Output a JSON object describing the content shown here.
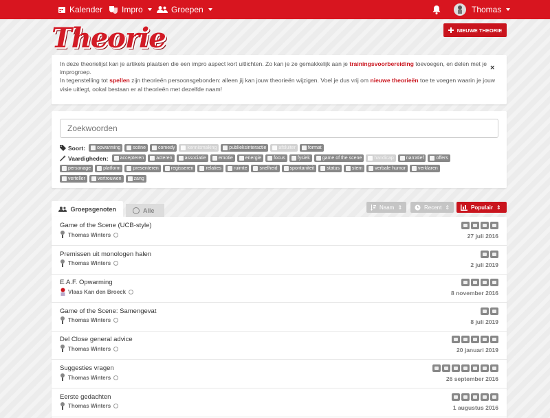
{
  "nav": {
    "calendar_label": "Kalender",
    "impro_label": "Impro",
    "groups_label": "Groepen",
    "user_name": "Thomas"
  },
  "page": {
    "logo_text": "Theorie",
    "new_button_label": "NIEUWE THEORIE"
  },
  "info": {
    "line1_a": "In deze theorielijst kan je artikels plaatsen die een impro aspect kort uitlichten. Zo kan je ze gemakkelijk aan je ",
    "line1_link": "trainingsvoorbereiding",
    "line1_b": " toevoegen, en delen met je improgroep.",
    "line2_a": "In tegenstelling tot ",
    "line2_link1": "spellen",
    "line2_b": " zijn theorieën persoonsgebonden: alleen jij kan jouw theorieën wijzigen. Voel je dus vrij om ",
    "line2_link2": "nieuwe theorieën",
    "line2_c": " toe te voegen waarin je jouw visie uitlegt, ookal bestaan er al theorieën met dezelfde naam!",
    "close": "×"
  },
  "search": {
    "placeholder": "Zoekwoorden",
    "sort_label": "Soort:",
    "sort_tags": [
      {
        "label": "opwarming",
        "light": false
      },
      {
        "label": "scène",
        "light": false
      },
      {
        "label": "comedy",
        "light": false
      },
      {
        "label": "kennismaking",
        "light": true
      },
      {
        "label": "publieksinteractie",
        "light": false
      },
      {
        "label": "afsluiter",
        "light": true
      },
      {
        "label": "format",
        "light": false
      }
    ],
    "skills_label": "Vaardigheden:",
    "skill_tags_row1": [
      {
        "label": "accepteren",
        "light": false
      },
      {
        "label": "acteren",
        "light": false
      },
      {
        "label": "associatie",
        "light": false
      },
      {
        "label": "emotie",
        "light": false
      },
      {
        "label": "energie",
        "light": false
      },
      {
        "label": "focus",
        "light": false
      },
      {
        "label": "fysiek",
        "light": false
      },
      {
        "label": "game of the scene",
        "light": false
      },
      {
        "label": "handicap",
        "light": true
      },
      {
        "label": "narratief",
        "light": false
      },
      {
        "label": "offers",
        "light": false
      }
    ],
    "skill_tags_row2": [
      {
        "label": "personage",
        "light": false
      },
      {
        "label": "platform",
        "light": false
      },
      {
        "label": "presenteren",
        "light": false
      },
      {
        "label": "regisseren",
        "light": false
      },
      {
        "label": "relaties",
        "light": false
      },
      {
        "label": "ruimte",
        "light": false
      },
      {
        "label": "snelheid",
        "light": false
      },
      {
        "label": "spontaniteit",
        "light": false
      },
      {
        "label": "status",
        "light": false
      },
      {
        "label": "stem",
        "light": false
      },
      {
        "label": "verbale humor",
        "light": false
      },
      {
        "label": "verklaren",
        "light": false
      }
    ],
    "skill_tags_row3": [
      {
        "label": "verteller",
        "light": false
      },
      {
        "label": "vertrouwen",
        "light": false
      },
      {
        "label": "zang",
        "light": false
      }
    ]
  },
  "tabs": {
    "group_label": "Groepsgenoten",
    "all_label": "Alle"
  },
  "sort_buttons": {
    "name_label": "Naam",
    "recent_label": "Recent",
    "popular_label": "Populair"
  },
  "theories": [
    {
      "title": "Game of the Scene (UCB-style)",
      "author": "Thomas Winters",
      "date": "27 juli 2016",
      "icon_count": 4
    },
    {
      "title": "Premissen uit monologen halen",
      "author": "Thomas Winters",
      "date": "2 juli 2019",
      "icon_count": 2
    },
    {
      "title": "E.A.F. Opwarming",
      "author": "Vlaas Kan den Broeck",
      "date": "8 november 2016",
      "icon_count": 4
    },
    {
      "title": "Game of the Scene: Samengevat",
      "author": "Thomas Winters",
      "date": "8 juli 2019",
      "icon_count": 2
    },
    {
      "title": "Del Close general advice",
      "author": "Thomas Winters",
      "date": "20 januari 2019",
      "icon_count": 5
    },
    {
      "title": "Suggesties vragen",
      "author": "Thomas Winters",
      "date": "26 september 2016",
      "icon_count": 7
    },
    {
      "title": "Eerste gedachten",
      "author": "Thomas Winters",
      "date": "1 augustus 2016",
      "icon_count": 5
    }
  ],
  "colors": {
    "brand_red": "#d8151f",
    "tag_grey": "#888888",
    "tag_disabled": "#d2d2d2"
  }
}
